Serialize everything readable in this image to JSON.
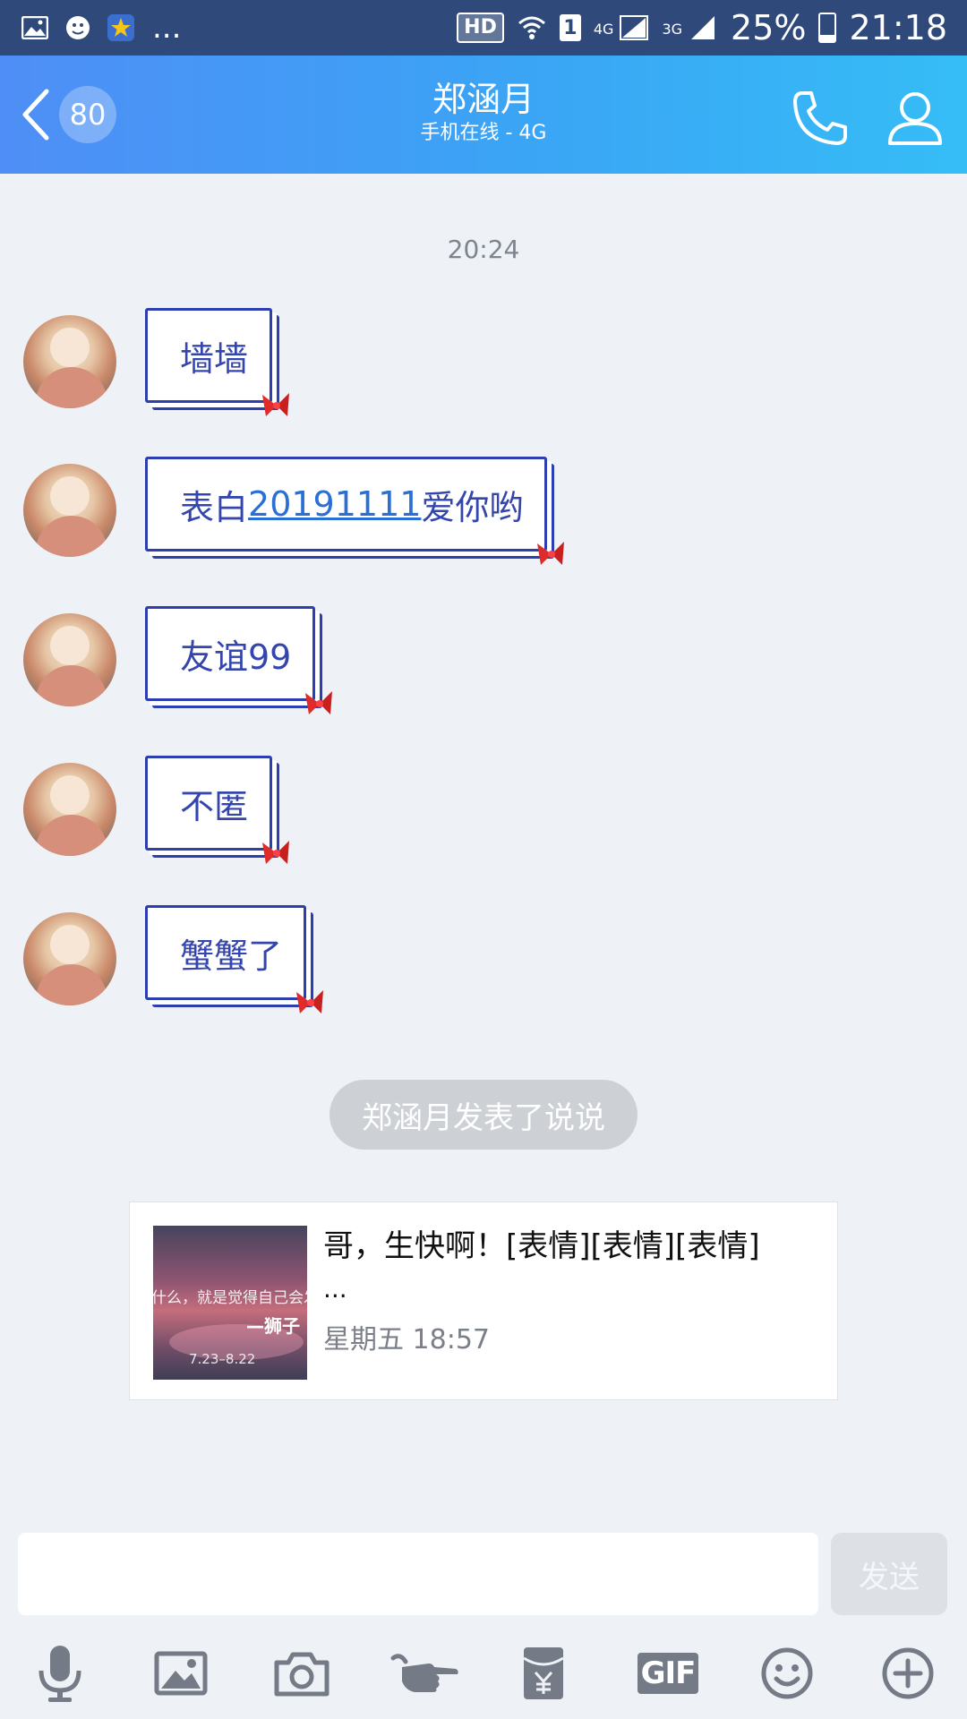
{
  "status_bar": {
    "notif_ellipsis": "...",
    "hd_label": "HD",
    "sim_label": "1",
    "net1_label": "4G",
    "net2_label": "3G",
    "battery_text": "25%",
    "time": "21:18"
  },
  "header": {
    "unread_count": "80",
    "contact_name": "郑涵月",
    "contact_status": "手机在线 - 4G"
  },
  "chat": {
    "time_divider": "20:24",
    "messages": [
      {
        "text": "墙墙"
      },
      {
        "text_before": "表白",
        "link": "20191111",
        "text_after": "爱你哟"
      },
      {
        "text": "友谊99"
      },
      {
        "text": "不匿"
      },
      {
        "text": "蟹蟹了"
      }
    ],
    "system_notice": "郑涵月发表了说说",
    "shared_post": {
      "text": "哥，生快啊！[表情][表情][表情]",
      "ellipsis": "...",
      "time": "星期五 18:57",
      "thumb_line1": "什么，就是觉得自己会发",
      "thumb_line2": "—狮子",
      "thumb_line3": "7.23–8.22"
    }
  },
  "input": {
    "value": "",
    "send_label": "发送"
  },
  "toolbar": {
    "icons": [
      "microphone-icon",
      "image-icon",
      "camera-icon",
      "poke-icon",
      "red-packet-icon",
      "gif-icon",
      "emoji-icon",
      "plus-icon"
    ],
    "gif_label": "GIF"
  },
  "colors": {
    "header_gradient_start": "#4f8ef6",
    "header_gradient_end": "#36bdf6",
    "bubble_border": "#2d3fb0",
    "bubble_text": "#3446ad",
    "link": "#2a6fd6",
    "background": "#eef1f6"
  }
}
